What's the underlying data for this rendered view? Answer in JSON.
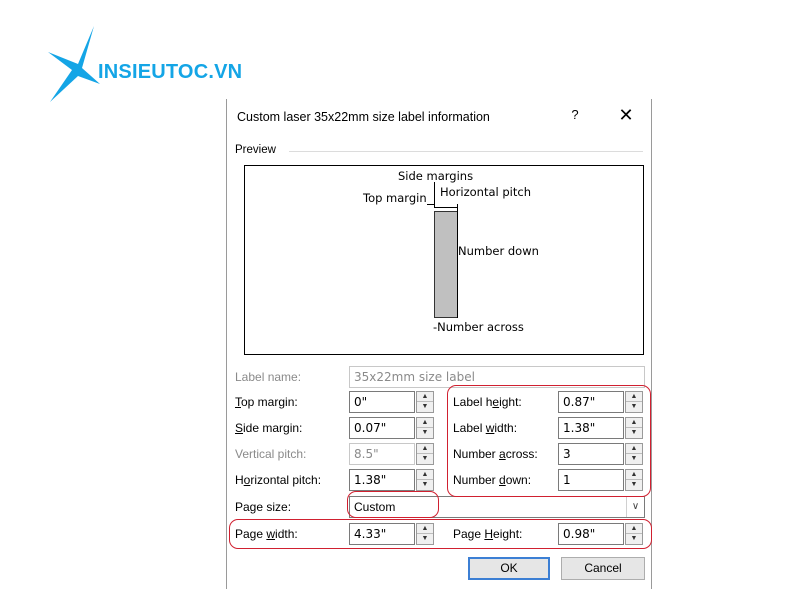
{
  "watermark": {
    "text": "INSIEUTOC.VN",
    "color": "#14a5e6"
  },
  "dialog": {
    "title": "Custom laser 35x22mm size label information",
    "help": "?",
    "close": "✕"
  },
  "preview": {
    "group_label": "Preview",
    "side_margins": "Side margins",
    "horizontal_pitch": "Horizontal pitch",
    "top_margin": "Top margin",
    "number_down": "Number down",
    "number_across": "-Number across"
  },
  "form": {
    "label_name": {
      "label": "Label name:",
      "value": "35x22mm size label"
    },
    "top_margin": {
      "label_pre": "",
      "label_u": "T",
      "label_post": "op margin:",
      "value": "0\""
    },
    "side_margin": {
      "label_u": "S",
      "label_post": "ide margin:",
      "value": "0.07\""
    },
    "vertical_pitch": {
      "label": "Vertical pitch:",
      "value": "8.5\""
    },
    "horizontal_pitch": {
      "label_pre": "H",
      "label_u": "o",
      "label_post": "rizontal pitch:",
      "value": "1.38\""
    },
    "label_height": {
      "label_pre": "Label h",
      "label_u": "e",
      "label_post": "ight:",
      "value": "0.87\""
    },
    "label_width": {
      "label_pre": "Label ",
      "label_u": "w",
      "label_post": "idth:",
      "value": "1.38\""
    },
    "number_across": {
      "label_pre": "Number ",
      "label_u": "a",
      "label_post": "cross:",
      "value": "3"
    },
    "number_down": {
      "label_pre": "Number ",
      "label_u": "d",
      "label_post": "own:",
      "value": "1"
    },
    "page_size": {
      "label": "Page size:",
      "value": "Custom"
    },
    "page_width": {
      "label_pre": "Page ",
      "label_u": "w",
      "label_post": "idth:",
      "value": "4.33\""
    },
    "page_height": {
      "label_pre": "Page ",
      "label_u": "H",
      "label_post": "eight:",
      "value": "0.98\""
    }
  },
  "buttons": {
    "ok": "OK",
    "cancel": "Cancel"
  },
  "colors": {
    "highlight": "#d02030",
    "primary_border": "#3c7fd4"
  }
}
